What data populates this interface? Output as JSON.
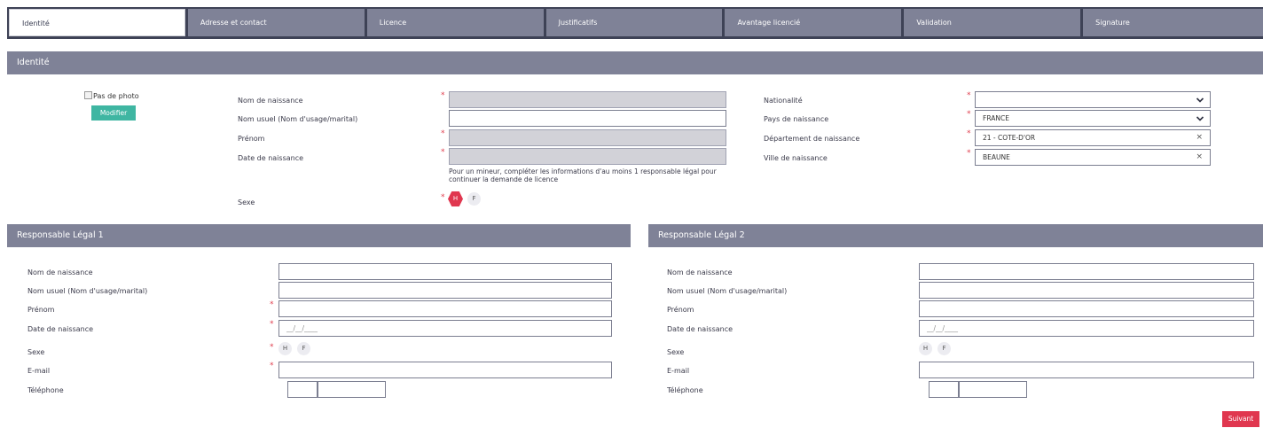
{
  "tabs": [
    "Identité",
    "Adresse et contact",
    "Licence",
    "Justificatifs",
    "Avantage licencié",
    "Validation",
    "Signature"
  ],
  "identite": {
    "title": "Identité",
    "photo_alt": "Pas de photo",
    "modifier_label": "Modifier",
    "nom_naissance_label": "Nom de naissance",
    "nom_usuel_label": "Nom usuel (Nom d'usage/marital)",
    "prenom_label": "Prénom",
    "date_naissance_label": "Date de naissance",
    "mineur_note": "Pour un mineur, compléter les informations d'au moins 1 responsable légal pour continuer la demande de licence",
    "sexe_label": "Sexe",
    "sexe_h": "H",
    "sexe_f": "F",
    "nationalite_label": "Nationalité",
    "nationalite_value": "",
    "pays_label": "Pays de naissance",
    "pays_value": "FRANCE",
    "departement_label": "Département de naissance",
    "departement_value": "21 - COTE-D'OR",
    "ville_label": "Ville de naissance",
    "ville_value": "BEAUNE"
  },
  "responsable1": {
    "title": "Responsable Légal 1",
    "nom_naissance_label": "Nom de naissance",
    "nom_usuel_label": "Nom usuel (Nom d'usage/marital)",
    "prenom_label": "Prénom",
    "date_naissance_label": "Date de naissance",
    "date_placeholder": "__/__/____",
    "sexe_label": "Sexe",
    "sexe_h": "H",
    "sexe_f": "F",
    "email_label": "E-mail",
    "telephone_label": "Téléphone"
  },
  "responsable2": {
    "title": "Responsable Légal 2",
    "nom_naissance_label": "Nom de naissance",
    "nom_usuel_label": "Nom usuel (Nom d'usage/marital)",
    "prenom_label": "Prénom",
    "date_naissance_label": "Date de naissance",
    "date_placeholder": "__/__/____",
    "sexe_label": "Sexe",
    "sexe_h": "H",
    "sexe_f": "F",
    "email_label": "E-mail",
    "telephone_label": "Téléphone"
  },
  "required_mark": "*",
  "clear_mark": "×",
  "suivant_label": "Suivant",
  "colors": {
    "header": "#7f8297",
    "tabbar": "#3e4256",
    "accent_red": "#e0374f",
    "teal": "#3fb6a2"
  }
}
